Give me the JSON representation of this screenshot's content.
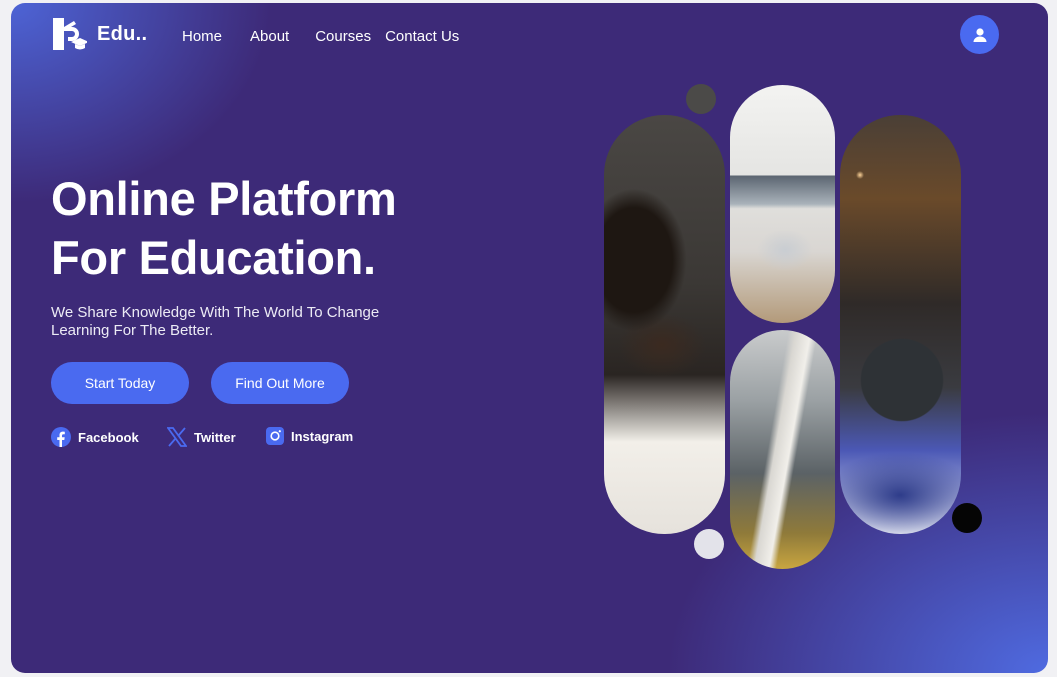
{
  "brand": {
    "name": "Edu..",
    "logo_icon": "book-mortarboard-icon"
  },
  "nav": {
    "items": [
      {
        "label": "Home"
      },
      {
        "label": "About"
      },
      {
        "label": "Courses"
      },
      {
        "label": "Contact Us"
      }
    ]
  },
  "profile": {
    "icon": "user-icon"
  },
  "hero": {
    "title_line1": "Online Platform",
    "title_line2": "For Education.",
    "subtitle": "We Share Knowledge With The World To Change Learning For The Better.",
    "primary_button": "Start Today",
    "secondary_button": "Find Out More"
  },
  "social": [
    {
      "label": "Facebook",
      "icon": "facebook-icon"
    },
    {
      "label": "Twitter",
      "icon": "x-twitter-icon"
    },
    {
      "label": "Instagram",
      "icon": "instagram-icon"
    }
  ],
  "collage": {
    "images": [
      "student-reading-book-photo",
      "laptop-on-desk-photo",
      "window-sill-photo",
      "globe-and-notebook-photo"
    ]
  },
  "colors": {
    "background": "#3d2a78",
    "accent": "#4a6af0",
    "text": "#ffffff"
  }
}
